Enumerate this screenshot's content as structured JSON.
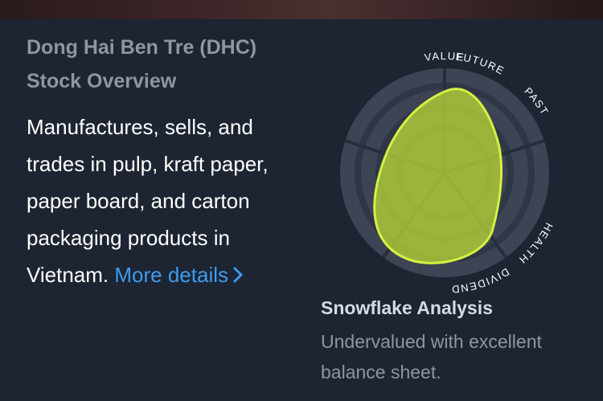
{
  "overview": {
    "title": "Dong Hai Ben Tre (DHC) Stock Overview",
    "description": "Manufactures, sells, and trades in pulp, kraft paper, paper board, and carton packaging products in Vietnam.",
    "more_details_label": "More details"
  },
  "snowflake": {
    "axes": [
      "VALUE",
      "FUTURE",
      "PAST",
      "HEALTH",
      "DIVIDEND"
    ],
    "title": "Snowflake Analysis",
    "summary": "Undervalued with excellent balance sheet.",
    "fill_color": "#b5d336",
    "stroke_color": "#d5f041"
  },
  "colors": {
    "background": "#1d2432",
    "link": "#3e9cf0",
    "muted_text": "#8f96a3"
  }
}
